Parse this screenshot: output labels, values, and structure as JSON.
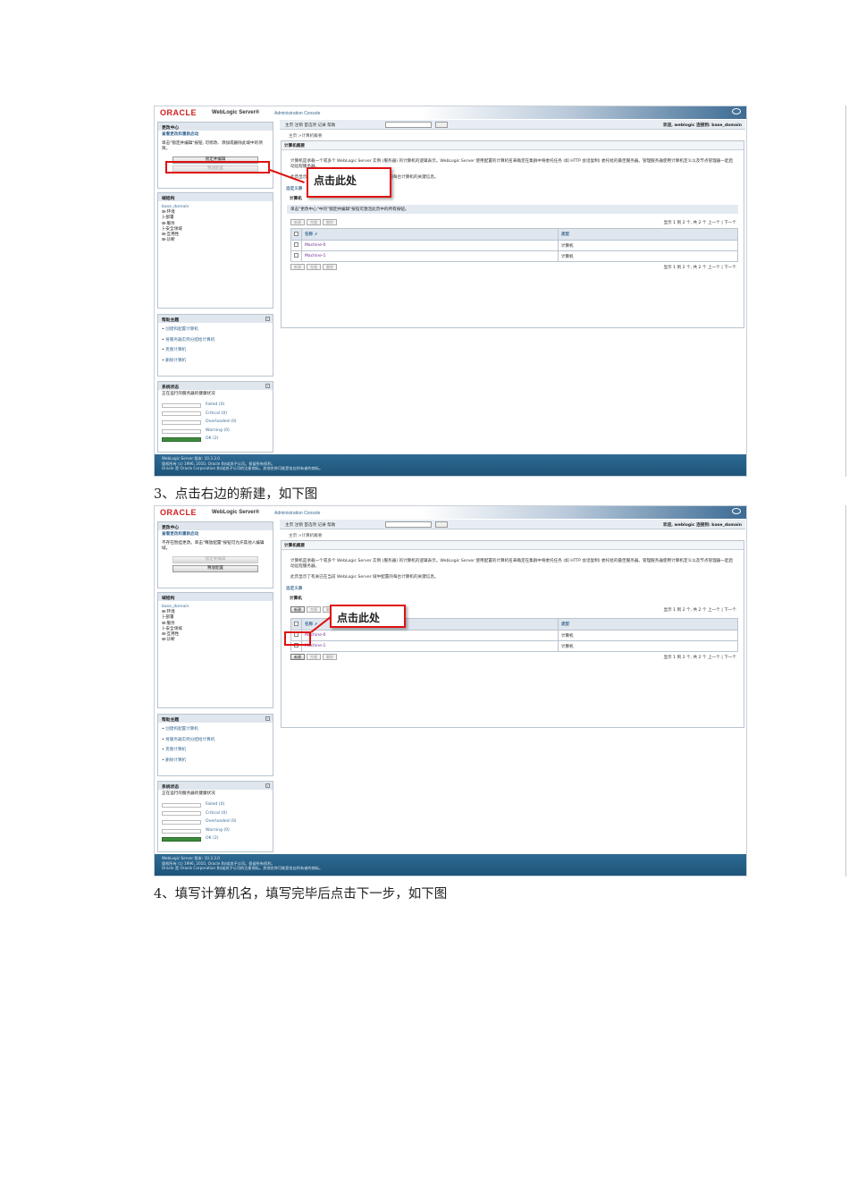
{
  "captions": {
    "step3": "3、点击右边的新建，如下图",
    "step4": "4、填写计算机名，填写完毕后点击下一步，如下图"
  },
  "console": {
    "logo": "ORACLE",
    "product": "WebLogic Server®",
    "subtitle": "Administration Console",
    "toolbar_links": "主页  注销  首选项  记录  帮助",
    "welcome": "欢迎, weblogic   连接到: base_domain",
    "breadcrumb": "主页 >计算机概要",
    "change_center": {
      "title": "更改中心",
      "subtitle": "查看更改和重新启动",
      "s1_text": "单击\"锁定并编辑\"按钮, 可修改、添加或删除此域中的项目。",
      "s2_text": "不存在暂挂更改。单击\"释放配置\"按钮可允许其他人编辑域。",
      "lock_edit": "锁定并编辑",
      "release_config": "释放配置"
    },
    "domain_structure": {
      "title": "域结构",
      "items": [
        "base_domain",
        "⊞-环境",
        "├-部署",
        "⊞-服务",
        "├-安全领域",
        "⊞-互用性",
        "⊞-诊断"
      ]
    },
    "help_topics": {
      "title": "帮助主题",
      "items": [
        "创建和配置计算机",
        "将服务器实例分配给计算机",
        "克隆计算机",
        "删除计算机"
      ]
    },
    "system_status": {
      "title": "系统状态",
      "subtitle": "正在运行的服务器的健康状况",
      "rows": [
        {
          "label": "Failed (0)",
          "value": 0
        },
        {
          "label": "Critical (0)",
          "value": 0
        },
        {
          "label": "Overloaded (0)",
          "value": 0
        },
        {
          "label": "Warning (0)",
          "value": 0
        },
        {
          "label": "OK (2)",
          "value": 1
        }
      ]
    },
    "main": {
      "title": "计算机概要",
      "para1": "计算机是承载一个或多个 WebLogic Server 实例 (服务器) 的计算机的逻辑表示。WebLogic Server 使用配置的计算机名来确定在集群中将委托任务 (如 HTTP 会话复制) 委托给的最佳服务器。管理服务器使用计算机定义以及节点管理器一起启动远程服务器。",
      "para2": "此页显示了有关已在当前 WebLogic Server 域中配置的每台计算机的关键信息。",
      "customize": "自定义表",
      "table_title": "计算机",
      "table_desc": "单击\"更改中心\"中的\"锁定并编辑\"按钮可激活此页中的所有按钮。",
      "buttons": [
        "新建",
        "克隆",
        "删除"
      ],
      "pager": "显示 1 到 2 个, 共 2 个   上一个 | 下一个",
      "columns": [
        "名称 ⇗",
        "类型"
      ],
      "rows": [
        {
          "name": "Machine-0",
          "type": "计算机"
        },
        {
          "name": "Machine-1",
          "type": "计算机"
        }
      ]
    },
    "footer": {
      "line1": "WebLogic Server 版本: 10.3.3.0",
      "line2": "版权所有 (c) 1996, 2010, Oracle 和/或其子公司。保留所有权利。",
      "line3": "Oracle 是 Oracle Corporation 和/或其子公司的注册商标。其他名称可能是各自所有者的商标。"
    },
    "callout": "点击此处"
  }
}
